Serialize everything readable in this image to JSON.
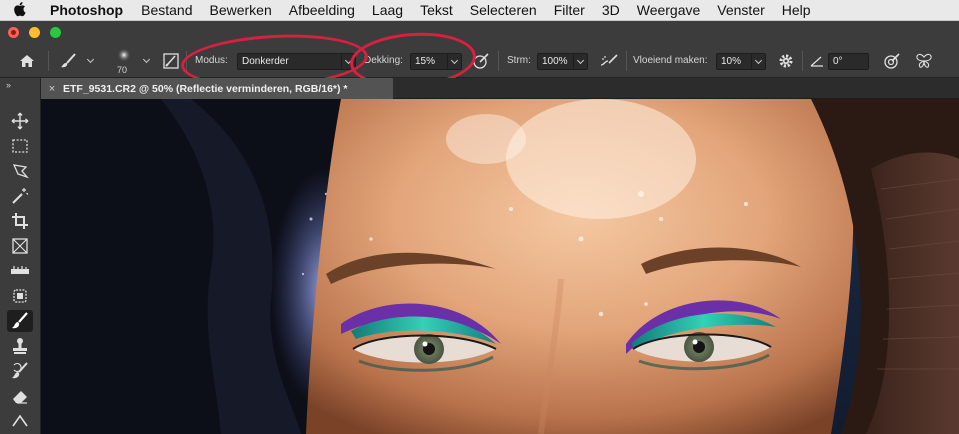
{
  "menubar": {
    "apple_icon": "apple-icon",
    "app_name": "Photoshop",
    "items": [
      "Bestand",
      "Bewerken",
      "Afbeelding",
      "Laag",
      "Tekst",
      "Selecteren",
      "Filter",
      "3D",
      "Weergave",
      "Venster",
      "Help"
    ]
  },
  "options": {
    "brush_size": "70",
    "mode_label": "Modus:",
    "mode_value": "Donkerder",
    "opacity_label": "Dekking:",
    "opacity_value": "15%",
    "flow_label": "Strm:",
    "flow_value": "100%",
    "smoothing_label": "Vloeiend maken:",
    "smoothing_value": "10%",
    "angle_value": "0°"
  },
  "document": {
    "tab_title": "ETF_9531.CR2 @ 50% (Reflectie verminderen, RGB/16*) *",
    "close_symbol": "×"
  },
  "toolbar": {
    "collapse_symbol": "››",
    "tools": [
      "move-tool-icon",
      "marquee-tool-icon",
      "lasso-tool-icon",
      "magic-wand-tool-icon",
      "crop-tool-icon",
      "frame-tool-icon",
      "ruler-tool-icon",
      "healing-tool-icon",
      "brush-tool-icon",
      "stamp-tool-icon",
      "history-brush-tool-icon",
      "eraser-tool-icon",
      "gradient-tool-icon"
    ],
    "active_tool": "brush-tool-icon"
  },
  "colors": {
    "annotation": "#d8203f",
    "eyeshadow_purple": "#6b2fa8",
    "eyeshadow_teal": "#1fb3a0"
  }
}
